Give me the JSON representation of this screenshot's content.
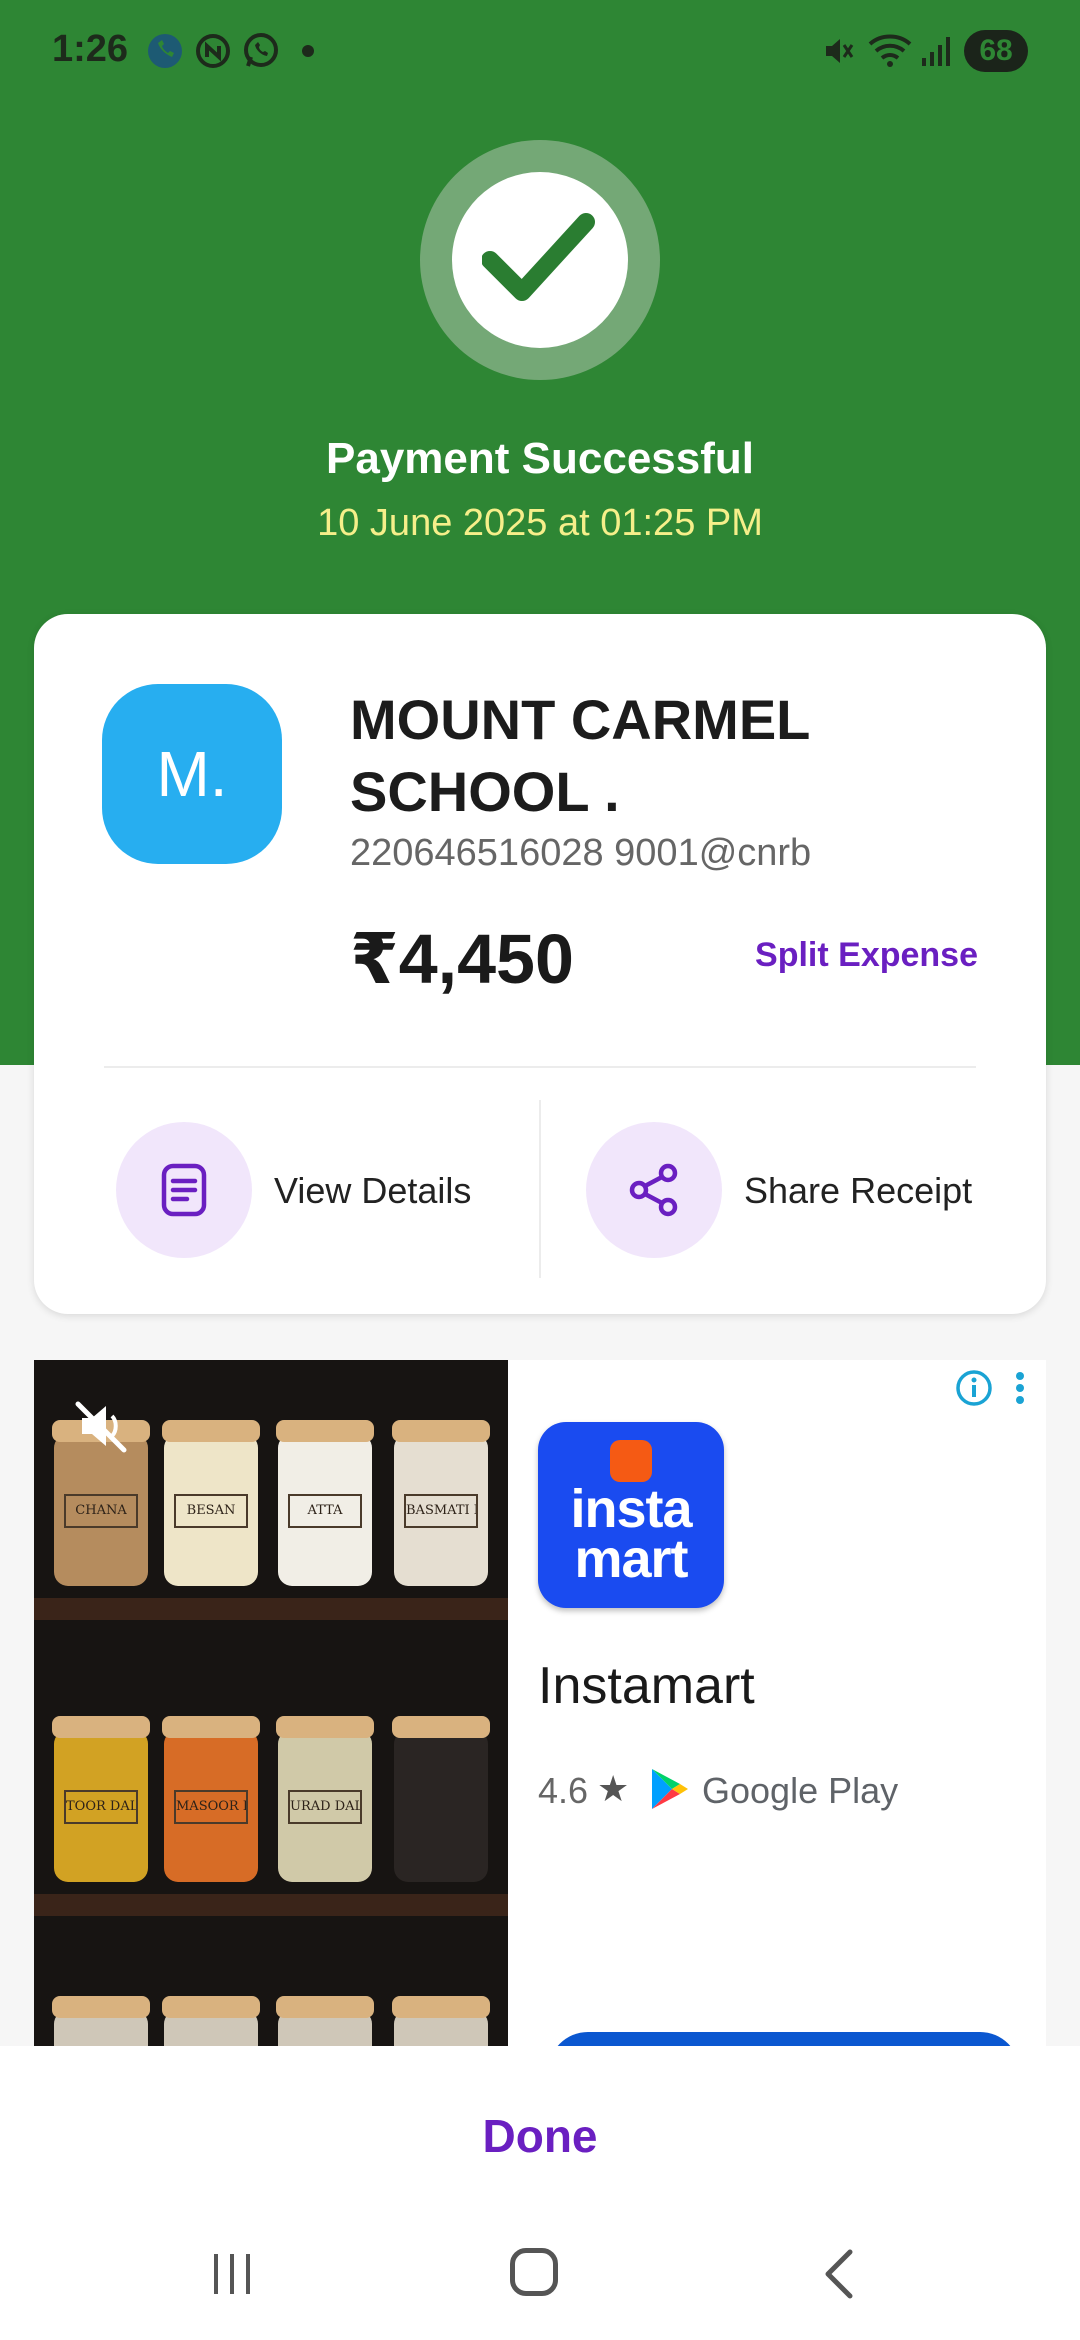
{
  "status_bar": {
    "time": "1:26",
    "battery": "68",
    "icons": [
      "phone-call-icon",
      "app-notification-icon",
      "whatsapp-icon",
      "dot-icon",
      "mute-icon",
      "wifi-icon",
      "signal-icon",
      "battery-icon"
    ]
  },
  "header": {
    "status_icon": "check-icon",
    "title": "Payment Successful",
    "datetime": "10 June 2025 at 01:25 PM"
  },
  "payment": {
    "avatar_initial": "M.",
    "payee_name": "MOUNT CARMEL SCHOOL .",
    "upi_id": "220646516028 9001@cnrb",
    "amount": "₹4,450",
    "split_label": "Split Expense"
  },
  "actions": [
    {
      "label": "View Details",
      "icon": "document-icon"
    },
    {
      "label": "Share Receipt",
      "icon": "share-icon"
    }
  ],
  "ad": {
    "app_icon_text": "insta mart",
    "app_name": "Instamart",
    "rating": "4.6",
    "store": "Google Play",
    "jar_labels": [
      "CHANA",
      "BESAN",
      "ATTA",
      "BASMATI RICE",
      "TOOR DAL",
      "MASOOR DAL",
      "URAD DAL",
      ""
    ]
  },
  "footer": {
    "done_label": "Done"
  },
  "colors": {
    "success_green": "#2e8634",
    "accent_purple": "#6a1fc1",
    "avatar_blue": "#27aef0",
    "date_yellow": "#f6ef8a"
  }
}
